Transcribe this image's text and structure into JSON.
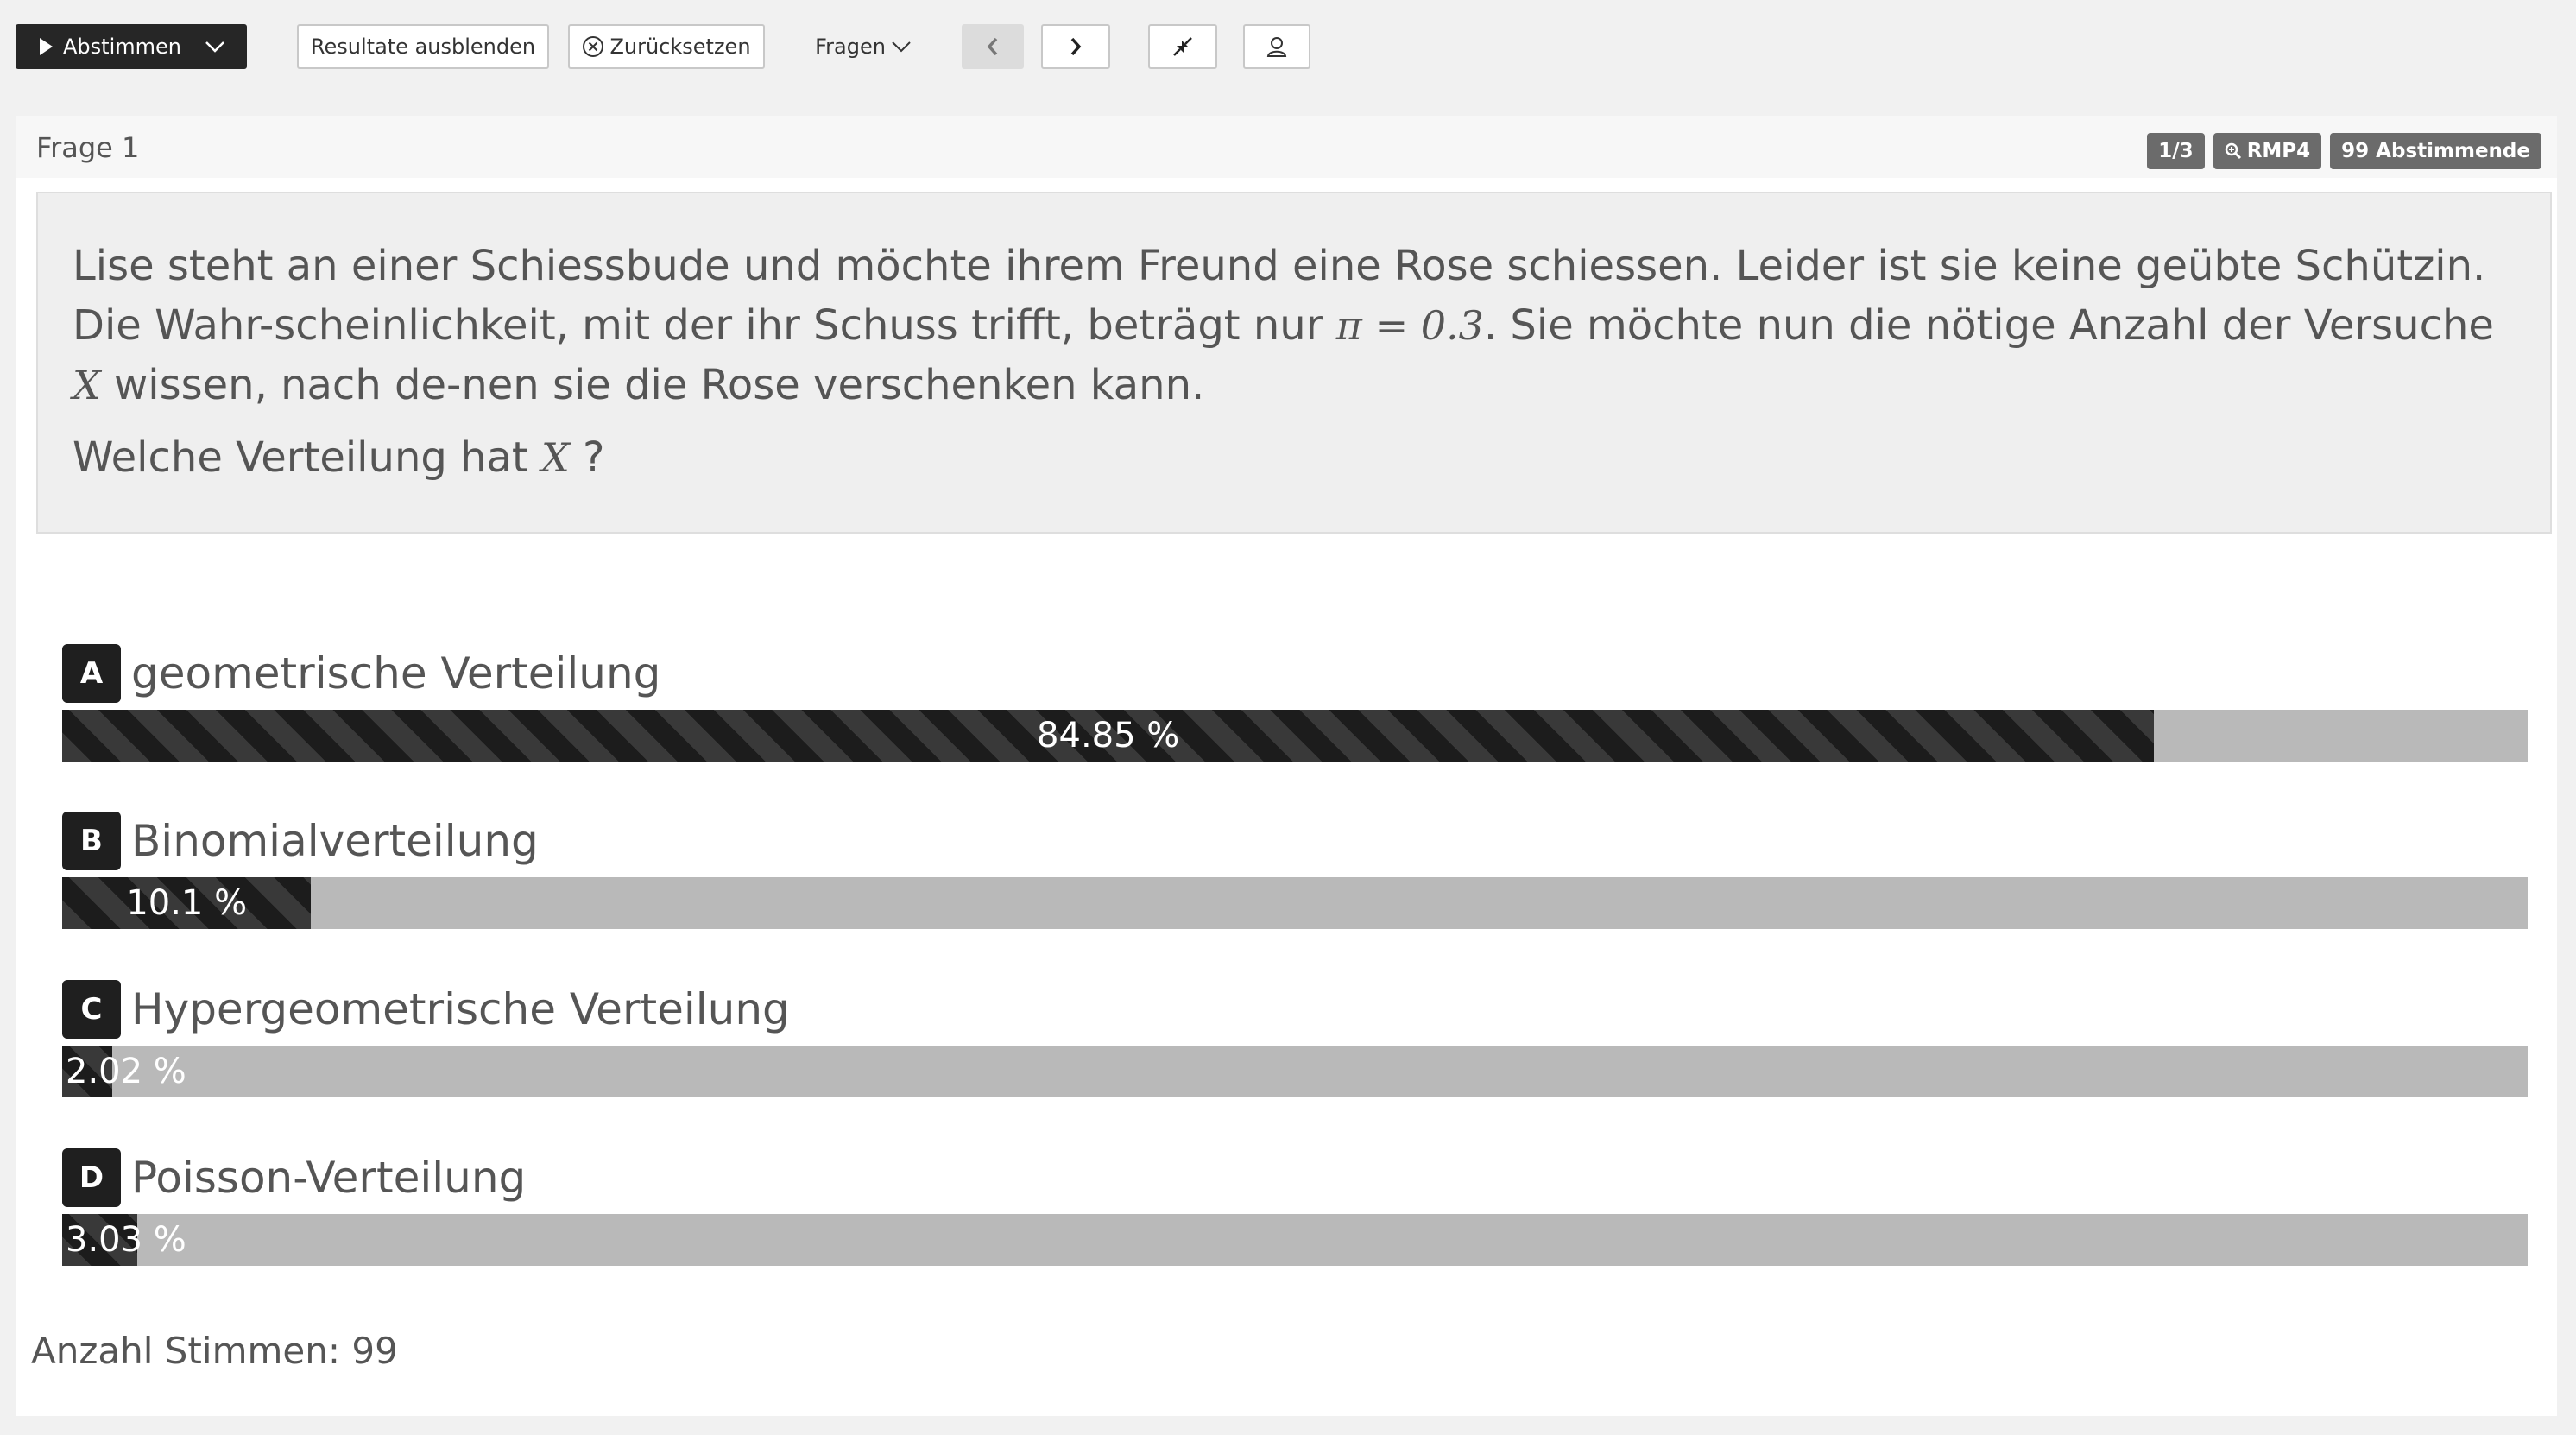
{
  "toolbar": {
    "vote_button": "Abstimmen",
    "hide_results": "Resultate ausblenden",
    "reset": "Zurücksetzen",
    "questions_menu": "Fragen"
  },
  "question": {
    "title": "Frage 1",
    "badges": {
      "position": "1/3",
      "room": "RMP4",
      "voters": "99 Abstimmende"
    },
    "text_part1": "Lise steht an einer Schiessbude und möchte ihrem Freund  eine Rose schiessen. Leider ist sie keine geübte Schützin. Die Wahr-scheinlichkeit, mit der ihr Schuss trifft, beträgt nur ",
    "math_pi": "π = 0.3",
    "text_part2": ". Sie möchte nun die nötige Anzahl der Versuche ",
    "math_x": "X",
    "text_part3": "  wissen, nach de-nen sie die Rose verschenken kann.",
    "prompt_part1": "Welche Verteilung hat ",
    "prompt_math": "X",
    "prompt_part2": " ?"
  },
  "answers": [
    {
      "letter": "A",
      "label": "geometrische Verteilung",
      "percent": 84.85,
      "percent_label": "84.85 %"
    },
    {
      "letter": "B",
      "label": "Binomialverteilung",
      "percent": 10.1,
      "percent_label": "10.1 %"
    },
    {
      "letter": "C",
      "label": "Hypergeometrische Verteilung",
      "percent": 2.02,
      "percent_label": "2.02 %"
    },
    {
      "letter": "D",
      "label": "Poisson-Verteilung",
      "percent": 3.03,
      "percent_label": "3.03 %"
    }
  ],
  "footer": {
    "votes_label": "Anzahl Stimmen: 99"
  },
  "colors": {
    "bar_fill": "#262626",
    "bar_track": "#b9b9b9",
    "badge": "#6b6b6b"
  }
}
